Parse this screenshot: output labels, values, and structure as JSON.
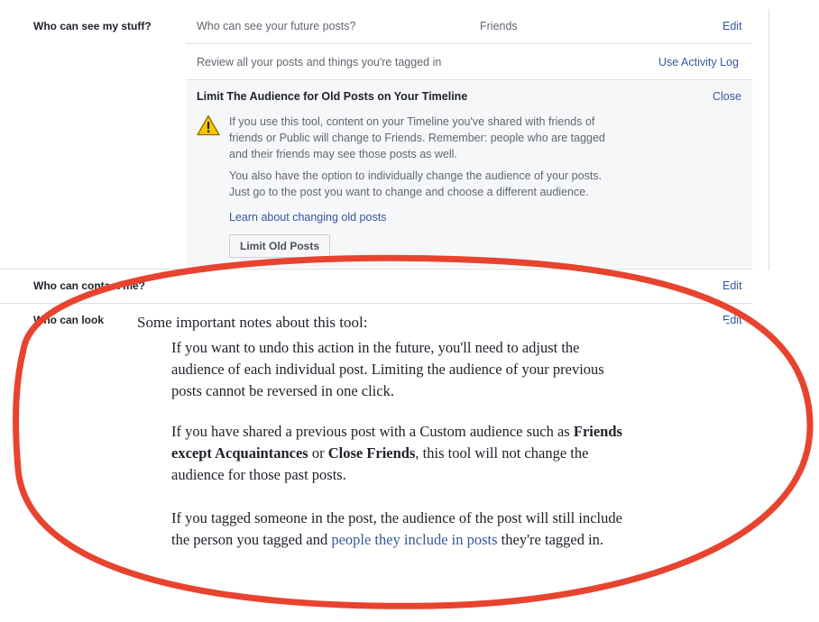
{
  "sections": {
    "see_stuff": {
      "label": "Who can see my stuff?",
      "future_posts": {
        "label": "Who can see your future posts?",
        "value": "Friends",
        "action": "Edit"
      },
      "review": {
        "label": "Review all your posts and things you're tagged in",
        "action": "Use Activity Log"
      },
      "limit": {
        "title": "Limit The Audience for Old Posts on Your Timeline",
        "close": "Close",
        "paragraph1": [
          "If you use this tool, content on your Timeline you've shared with friends of",
          "friends or Public will change to Friends. Remember: people who are tagged",
          "and their friends may see those posts as well."
        ],
        "paragraph2": [
          "You also have the option to individually change the audience of your posts.",
          "Just go to the post you want to change and choose a different audience."
        ],
        "learn_link": "Learn about changing old posts",
        "button": "Limit Old Posts"
      }
    },
    "contact": {
      "label": "Who can contact me?",
      "action": "Edit"
    },
    "look": {
      "label": "Who can look",
      "action": "Edit"
    }
  },
  "notes": {
    "heading": "Some important notes about this tool:",
    "p1": [
      "If you want to undo this action in the future, you'll need to adjust the",
      "audience of each individual post. Limiting the audience of your previous",
      "posts cannot be reversed in one click."
    ],
    "p2_line1_pre": "If you have shared a previous post with a Custom audience such as ",
    "p2_bold1": "Friends",
    "p2_bold2": "except Acquaintances",
    "p2_or": " or ",
    "p2_bold3": "Close Friends",
    "p2_line2_post": ", this tool will not change the",
    "p2_line3": "audience for those past posts.",
    "p3_line1": "If you tagged someone in the post, the audience of the post will still include",
    "p3_line2_pre": "the person you tagged and ",
    "p3_link": "people they include in posts",
    "p3_line2_post": " they're tagged in."
  },
  "colors": {
    "highlight_ellipse": "#e8432e",
    "link": "#365899",
    "warning": "#f7c600"
  }
}
